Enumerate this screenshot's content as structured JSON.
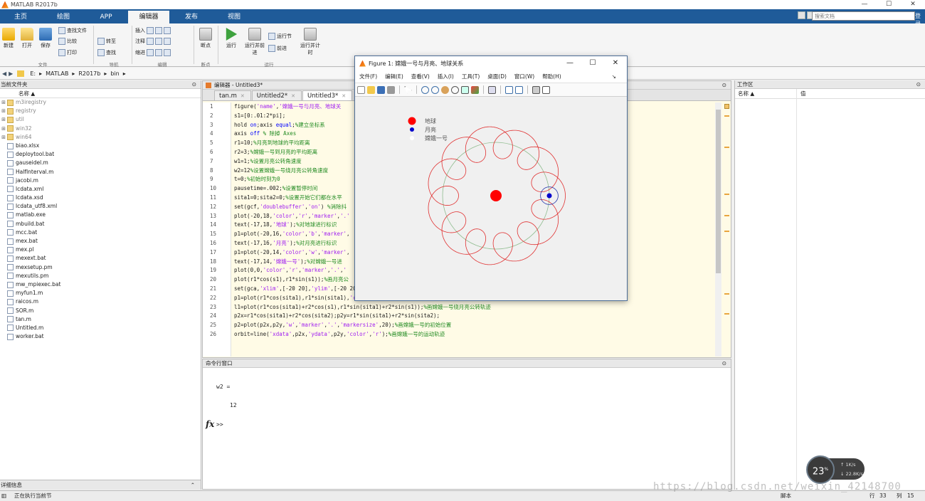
{
  "window": {
    "title": "MATLAB R2017b",
    "minimize": "—",
    "maximize": "☐",
    "close": "✕"
  },
  "ribbon": {
    "tabs": [
      "主页",
      "绘图",
      "APP",
      "编辑器",
      "发布",
      "视图"
    ],
    "active_tab": "编辑器",
    "search_placeholder": "搜索文档",
    "login": "登录",
    "buttons": {
      "new": "新建",
      "open": "打开",
      "save": "保存",
      "find_files": "查找文件",
      "compare": "比较",
      "print": "打印",
      "goto": "转至",
      "find": "查找",
      "insert": "插入",
      "comment": "注释",
      "indent": "缩进",
      "breakpoints": "断点",
      "run": "运行",
      "run_advance": "运行并前进",
      "run_section": "运行节",
      "advance": "前进",
      "run_time": "运行并计时"
    },
    "groups": {
      "file": "文件",
      "navigate": "导航",
      "edit": "编辑",
      "breakpoints": "断点",
      "run": "运行"
    }
  },
  "address": {
    "back": "◀",
    "forward": "▶",
    "path": [
      "E:",
      "MATLAB",
      "R2017b",
      "bin"
    ]
  },
  "file_browser": {
    "title": "当前文件夹",
    "column_name": "名称 ▲",
    "items": [
      {
        "name": "m3iregistry",
        "type": "folder",
        "dim": true
      },
      {
        "name": "registry",
        "type": "folder",
        "dim": true
      },
      {
        "name": "util",
        "type": "folder",
        "dim": true
      },
      {
        "name": "win32",
        "type": "folder",
        "dim": true
      },
      {
        "name": "win64",
        "type": "folder",
        "dim": true
      },
      {
        "name": "biao.xlsx",
        "type": "file"
      },
      {
        "name": "deploytool.bat",
        "type": "file"
      },
      {
        "name": "gauseidel.m",
        "type": "file"
      },
      {
        "name": "HalfInterval.m",
        "type": "file"
      },
      {
        "name": "jacobi.m",
        "type": "file"
      },
      {
        "name": "lcdata.xml",
        "type": "file"
      },
      {
        "name": "lcdata.xsd",
        "type": "file"
      },
      {
        "name": "lcdata_utf8.xml",
        "type": "file"
      },
      {
        "name": "matlab.exe",
        "type": "file"
      },
      {
        "name": "mbuild.bat",
        "type": "file"
      },
      {
        "name": "mcc.bat",
        "type": "file"
      },
      {
        "name": "mex.bat",
        "type": "file"
      },
      {
        "name": "mex.pl",
        "type": "file"
      },
      {
        "name": "mexext.bat",
        "type": "file"
      },
      {
        "name": "mexsetup.pm",
        "type": "file"
      },
      {
        "name": "mexutils.pm",
        "type": "file"
      },
      {
        "name": "mw_mpiexec.bat",
        "type": "file"
      },
      {
        "name": "myfun1.m",
        "type": "file"
      },
      {
        "name": "raicos.m",
        "type": "file"
      },
      {
        "name": "SOR.m",
        "type": "file"
      },
      {
        "name": "tan.m",
        "type": "file"
      },
      {
        "name": "Untitled.m",
        "type": "file"
      },
      {
        "name": "worker.bat",
        "type": "file"
      }
    ],
    "details_label": "详细信息"
  },
  "editor": {
    "title": "编辑器 - Untitled3*",
    "tabs": [
      "tan.m",
      "Untitled2*",
      "Untitled3*"
    ],
    "active_tab": "Untitled3*",
    "lines": [
      "figure('name','嫦娥一号与月亮、地球关",
      "s1=[0:.01:2*pi];",
      "hold on;axis equal;%建立坐标系",
      "axis off % 除掉 Axes",
      "r1=10;%月亮到地球的平均距离",
      "r2=3;%嫦娥一号到月亮的平均距离",
      "w1=1;%设置月亮公转角速度",
      "w2=12%设置嫦娥一号绕月亮公转角速度",
      "t=0;%初始时刻为0",
      "pausetime=.002;%设置暂停时间",
      "sita1=0;sita2=0;%设置开始它们都在水平",
      "set(gcf,'doublebuffer','on') %消除抖",
      "plot(-20,18,'color','r','marker','.'",
      "text(-17,18,'地球');%对地球进行标识",
      "p1=plot(-20,16,'color','b','marker',",
      "text(-17,16,'月亮');%对月亮进行标识",
      "p1=plot(-20,14,'color','w','marker',",
      "text(-17,14,'嫦娥一号');%对嫦娥一号进",
      "plot(0,0,'color','r','marker','.','",
      "plot(r1*cos(s1),r1*sin(s1));%画月亮公",
      "set(gca,'xlim',[-20 20],'ylim',[-20 20]);",
      "p1=plot(r1*cos(sita1),r1*sin(sita1),'color','b','marker','.','markersize',20);%画月亮初始位置",
      "l1=plot(r1*cos(sita1)+r2*cos(s1),r1*sin(sita1)+r2*sin(s1));%画嫦娥一号绕月亮公转轨迹",
      "p2x=r1*cos(sita1)+r2*cos(sita2);p2y=r1*sin(sita1)+r2*sin(sita2);",
      "p2=plot(p2x,p2y,'w','marker','.','markersize',20);%画嫦娥一号的初始位置",
      "orbit=line('xdata',p2x,'ydata',p2y,'color','r');%画嫦娥一号的运动轨迹"
    ]
  },
  "command_window": {
    "title": "命令行窗口",
    "output_var": "w2 =",
    "output_value": "12",
    "fx": "fx",
    "prompt": ">>"
  },
  "workspace": {
    "title": "工作区",
    "col_name": "名称 ▲",
    "col_value": "值"
  },
  "status": {
    "left": "正在执行当前节",
    "script": "脚本",
    "row_label": "行",
    "row": "33",
    "col_label": "列",
    "col": "15"
  },
  "net_widget": {
    "percent": "23",
    "percent_unit": "%",
    "up": "1K/s",
    "down": "22.8K/s"
  },
  "watermark": "https://blog.csdn.net/weixin_42148700",
  "figure": {
    "title": "Figure 1: 嫦娥一号与月亮、地球关系",
    "menus": [
      "文件(F)",
      "编辑(E)",
      "查看(V)",
      "插入(I)",
      "工具(T)",
      "桌面(D)",
      "窗口(W)",
      "帮助(H)"
    ],
    "legend": [
      "地球",
      "月亮",
      "嫦娥一号"
    ],
    "colors": {
      "earth": "#ff0000",
      "moon": "#0000cc",
      "orbit": "#e03030",
      "moon_orbit": "#8fbc8f"
    }
  },
  "chart_data": {
    "type": "scatter",
    "xlim": [
      -20,
      20
    ],
    "ylim": [
      -20,
      20
    ],
    "earth": {
      "x": 0,
      "y": 0
    },
    "moon_orbit_radius": 10,
    "moon_position": {
      "x": 10,
      "y": 0
    },
    "chang_e_orbit_radius": 3,
    "revolutions_ratio": 12,
    "legend_markers": [
      {
        "label": "地球",
        "x": -20,
        "y": 18,
        "color": "#ff0000"
      },
      {
        "label": "月亮",
        "x": -20,
        "y": 16,
        "color": "#0000cc"
      },
      {
        "label": "嫦娥一号",
        "x": -20,
        "y": 14,
        "color": "#ffffff"
      }
    ]
  }
}
